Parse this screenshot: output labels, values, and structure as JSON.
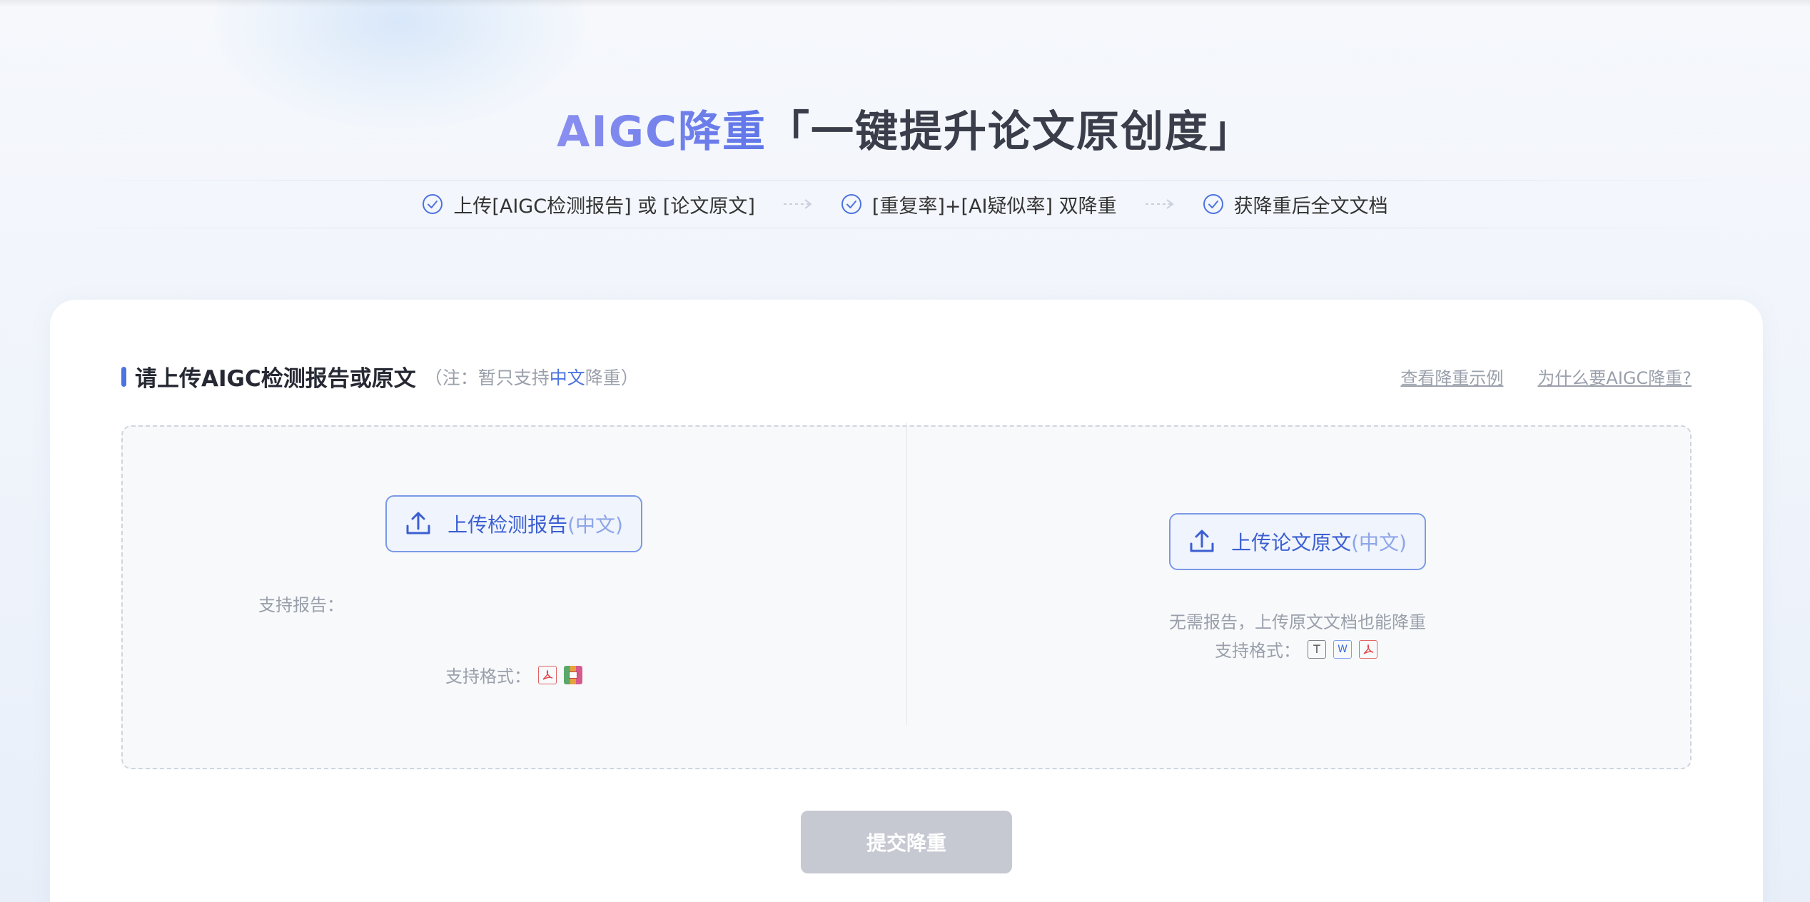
{
  "hero": {
    "title_accent": "AIGC降重",
    "title_rest": "「一键提升论文原创度」"
  },
  "steps": [
    {
      "label": "上传[AIGC检测报告] 或 [论文原文]"
    },
    {
      "label": "[重复率]+[AI疑似率] 双降重"
    },
    {
      "label": "获降重后全文文档"
    }
  ],
  "section": {
    "title": "请上传AIGC检测报告或原文",
    "note_prefix": "（注：暂只支持",
    "note_highlight": "中文",
    "note_suffix": "降重）",
    "link_example": "查看降重示例",
    "link_why": "为什么要AIGC降重?"
  },
  "left_panel": {
    "button_label": "上传检测报告",
    "button_suffix": "(中文)",
    "support_report_label": "支持报告：",
    "support_format_label": "支持格式：",
    "formats": [
      "pdf-icon",
      "zip-icon"
    ]
  },
  "right_panel": {
    "button_label": "上传论文原文",
    "button_suffix": "(中文)",
    "hint": "无需报告，上传原文文档也能降重",
    "support_format_label": "支持格式：",
    "formats": [
      "txt-icon",
      "word-icon",
      "pdf-icon"
    ]
  },
  "submit": {
    "label": "提交降重",
    "disabled": true
  },
  "colors": {
    "accent": "#4d73e0",
    "submit_disabled": "#c6c9d2"
  }
}
